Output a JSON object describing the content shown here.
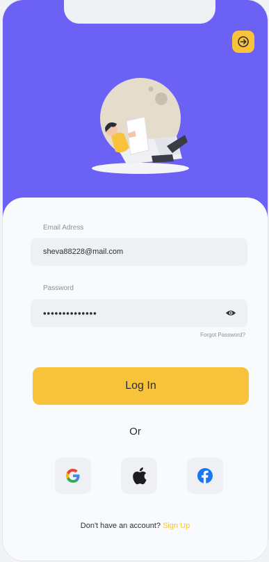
{
  "header": {
    "exit_icon": "arrow-right-icon",
    "brand_color": "#6b61f4",
    "accent_color": "#f8c33a"
  },
  "form": {
    "email_label": "Email Adress",
    "email_value": "sheva88228@mail.com",
    "password_label": "Password",
    "password_value": "••••••••••••••",
    "password_toggle_icon": "eye-icon",
    "forgot_link": "Forgot Password?",
    "login_button": "Log In",
    "divider_text": "Or"
  },
  "social": {
    "google_icon": "google-icon",
    "apple_icon": "apple-icon",
    "facebook_icon": "facebook-icon"
  },
  "footer": {
    "prompt": "Don't have an account?",
    "signup_link": "Sign Up"
  }
}
